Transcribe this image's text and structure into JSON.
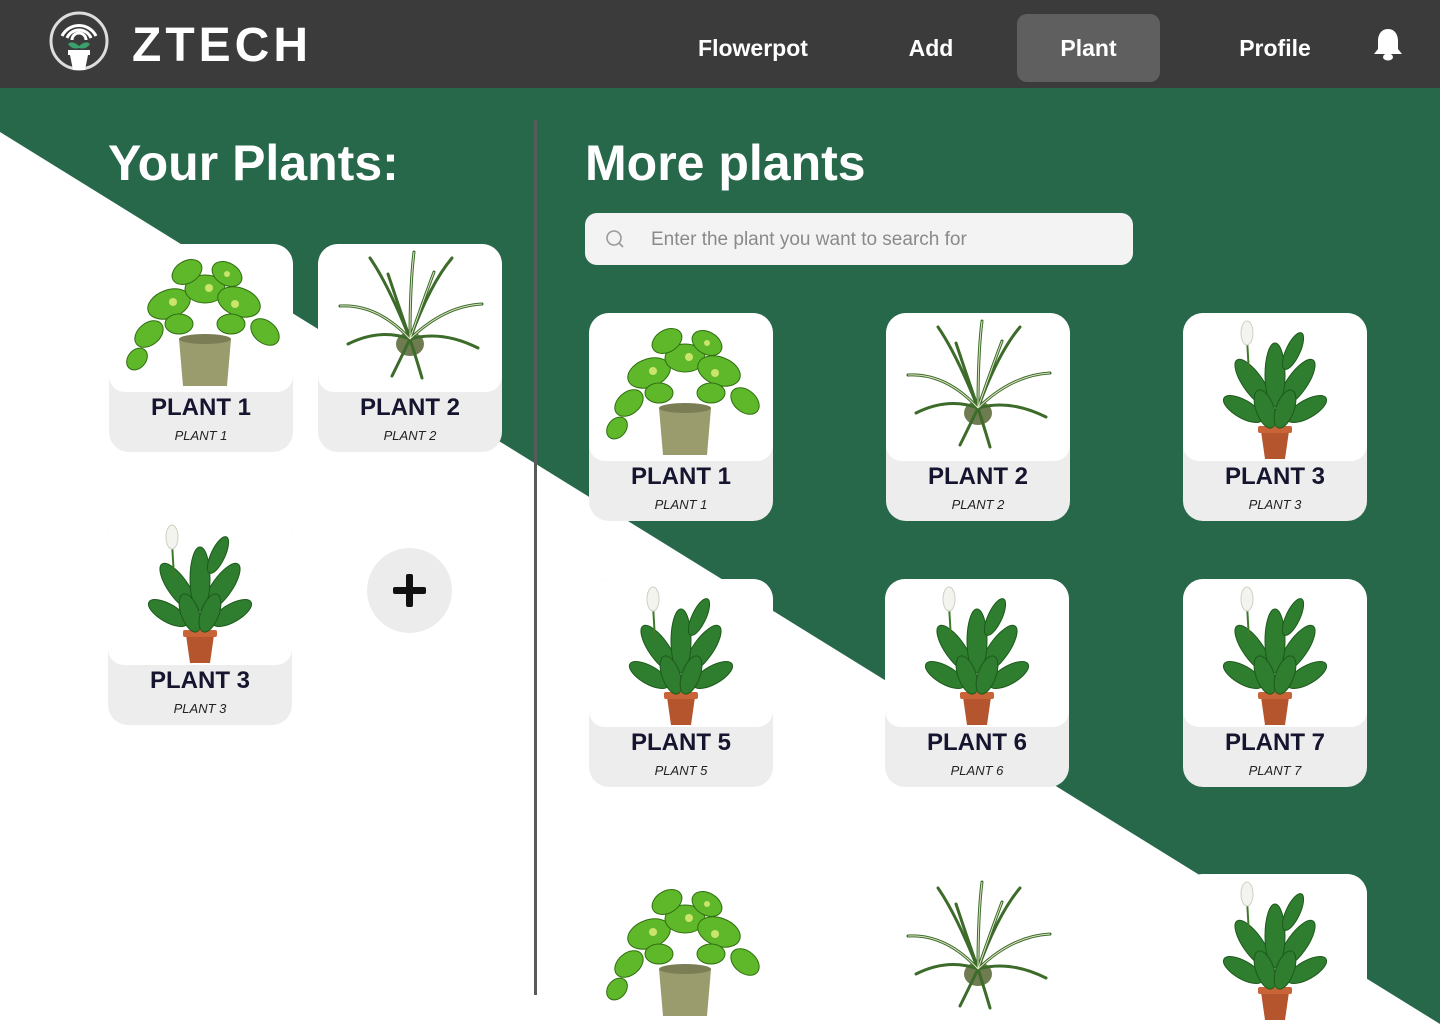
{
  "brand": {
    "name": "ZTECH"
  },
  "nav": {
    "items": [
      {
        "label": "Flowerpot"
      },
      {
        "label": "Add"
      },
      {
        "label": "Plant",
        "active": true
      },
      {
        "label": "Profile"
      }
    ],
    "notification_icon": "bell-icon"
  },
  "your_plants": {
    "title": "Your Plants:",
    "cards": [
      {
        "name": "PLANT 1",
        "sub": "PLANT 1",
        "plant": "pothos"
      },
      {
        "name": "PLANT 2",
        "sub": "PLANT 2",
        "plant": "spider-plant"
      },
      {
        "name": "PLANT 3",
        "sub": "PLANT 3",
        "plant": "peace-lily"
      }
    ],
    "add_icon": "plus-icon"
  },
  "more_plants": {
    "title": "More plants",
    "search": {
      "placeholder": "Enter the plant you want to search for",
      "value": "",
      "icon": "search-icon"
    },
    "cards": [
      {
        "name": "PLANT 1",
        "sub": "PLANT 1",
        "plant": "pothos"
      },
      {
        "name": "PLANT 2",
        "sub": "PLANT 2",
        "plant": "spider-plant"
      },
      {
        "name": "PLANT 3",
        "sub": "PLANT 3",
        "plant": "peace-lily"
      },
      {
        "name": "PLANT 5",
        "sub": "PLANT 5",
        "plant": "peace-lily"
      },
      {
        "name": "PLANT 6",
        "sub": "PLANT 6",
        "plant": "peace-lily"
      },
      {
        "name": "PLANT 7",
        "sub": "PLANT 7",
        "plant": "peace-lily"
      },
      {
        "plant": "pothos"
      },
      {
        "plant": "spider-plant"
      },
      {
        "plant": "peace-lily"
      }
    ]
  },
  "colors": {
    "green": "#27684b",
    "topbar": "#3b3b3b",
    "active_tab": "#5f5f5f",
    "card": "#ededed",
    "title_text": "#151530"
  }
}
